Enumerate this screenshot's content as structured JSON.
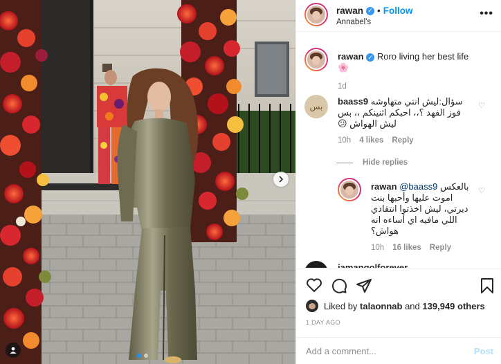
{
  "post": {
    "username": "rawan",
    "follow_label": "Follow",
    "location": "Annabel's",
    "more": "•••"
  },
  "caption": {
    "username": "rawan",
    "text": "Roro living her best life🌸",
    "age": "1d"
  },
  "comments": [
    {
      "username": "baass9",
      "text": "سؤال:ليش انتي متهاوشه",
      "text2": "فوز الفهد ؟،، احبكم اثنينكم ،، بس",
      "text3": "ليش الهواش 😕",
      "avatar_text": "بس",
      "time": "10h",
      "likes": "4 likes",
      "reply": "Reply"
    }
  ],
  "hide_replies": "Hide replies",
  "reply": {
    "username": "rawan",
    "mention": "@baass9",
    "line1": "بالعكس",
    "line2": "اموت عليها وأحبها بنت",
    "line3": "ديرتي، ليش اخذتوا انتقادي",
    "line4": "اللي مافيه اي أساءه انه",
    "line5": "هواش؟",
    "time": "10h",
    "likes": "16 likes",
    "reply_label": "Reply"
  },
  "partial_comment_user": "jamangolforever",
  "likes": {
    "prefix": "Liked by",
    "user": "talaonnab",
    "and": "and",
    "count": "139,949 others"
  },
  "date": "1 DAY AGO",
  "comment_input": {
    "placeholder": "Add a comment...",
    "post_label": "Post"
  },
  "colors": {
    "follow": "#0095f6",
    "post_disabled": "#b2dffc",
    "verified": "#3897f0"
  }
}
